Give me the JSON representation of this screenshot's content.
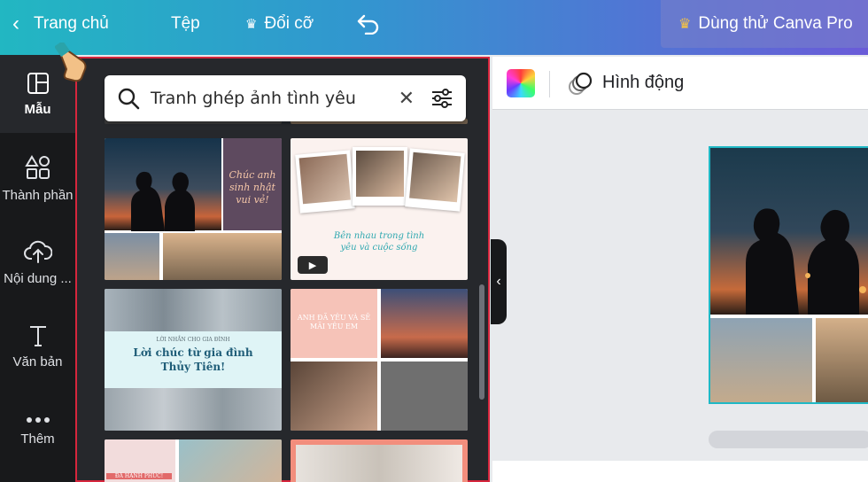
{
  "topbar": {
    "home_label": "Trang chủ",
    "file_label": "Tệp",
    "resize_label": "Đổi cỡ",
    "pro_label": "Dùng thử Canva Pro"
  },
  "rail": {
    "items": [
      {
        "label": "Mẫu",
        "icon": "template-icon",
        "active": true
      },
      {
        "label": "Thành phần",
        "icon": "elements-icon"
      },
      {
        "label": "Nội dung ...",
        "icon": "upload-cloud-icon"
      },
      {
        "label": "Văn bản",
        "icon": "text-icon"
      },
      {
        "label": "Thêm",
        "icon": "more-icon"
      }
    ]
  },
  "search": {
    "value": "Tranh ghép ảnh tình yêu"
  },
  "templates": [
    {
      "caption": "Chúc anh sinh nhật vui vẻ!"
    },
    {
      "caption": "Bên nhau trong tình yêu và cuộc sống"
    },
    {
      "caption_top": "LỜI NHẮN CHO GIA ĐÌNH",
      "caption": "Lời chúc từ gia đình Thủy Tiên!"
    },
    {
      "caption": "ANH ĐÃ YÊU VÀ SẼ MÃI YÊU EM"
    },
    {
      "caption": "ĐÃ HẠNH PHÚC!"
    },
    {
      "caption": ""
    }
  ],
  "editor": {
    "animate_label": "Hình động"
  },
  "colors": {
    "accent": "#1fb8c5",
    "panel_border": "#d7263d",
    "rail_bg": "#18191b",
    "panel_bg": "#26282c"
  }
}
